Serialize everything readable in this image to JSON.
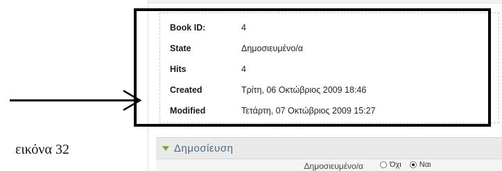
{
  "details": {
    "rows": [
      {
        "key": "Book ID:",
        "value": "4"
      },
      {
        "key": "State",
        "value": "Δημοσιευμένο/α"
      },
      {
        "key": "Hits",
        "value": "4"
      },
      {
        "key": "Created",
        "value": "Τρίτη, 06 Οκτώβριος 2009 18:46"
      },
      {
        "key": "Modified",
        "value": "Τετάρτη, 07 Οκτώβριος 2009 15:27"
      }
    ]
  },
  "caption": "εικόνα 32",
  "publish_section": {
    "title": "Δημοσίευση",
    "published_label": "Δημοσιευμένο/α",
    "options": [
      {
        "label": "Όχι",
        "checked": false
      },
      {
        "label": "Ναι",
        "checked": true
      }
    ]
  },
  "colors": {
    "frame": "#000000",
    "section_title": "#4b6a82",
    "triangle": "#78a843"
  }
}
